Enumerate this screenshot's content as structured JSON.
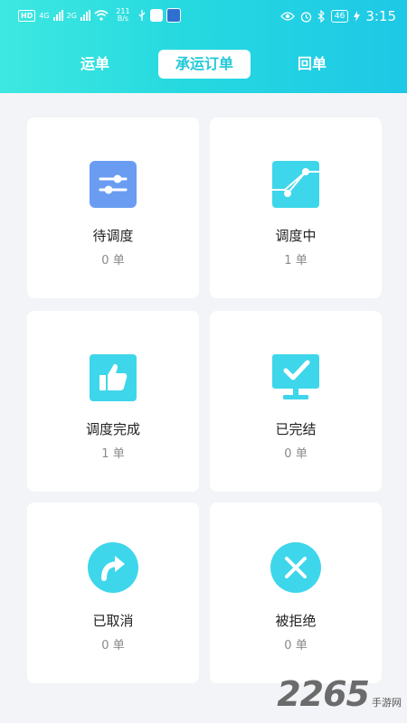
{
  "status_bar": {
    "hd_label": "HD",
    "network_1": "4G",
    "network_2": "2G",
    "speed": "211 B/s",
    "battery": "46",
    "time": "3:15"
  },
  "tabs": [
    {
      "label": "运单",
      "active": false
    },
    {
      "label": "承运订单",
      "active": true
    },
    {
      "label": "回单",
      "active": false
    }
  ],
  "cards": [
    {
      "title": "待调度",
      "count": "0 单",
      "icon": "sliders-icon",
      "color": "#6a9cf2"
    },
    {
      "title": "调度中",
      "count": "1 单",
      "icon": "route-icon",
      "color": "#3ed6ea"
    },
    {
      "title": "调度完成",
      "count": "1 单",
      "icon": "thumbs-up-icon",
      "color": "#3ed6ea"
    },
    {
      "title": "已完结",
      "count": "0 单",
      "icon": "monitor-check-icon",
      "color": "#3ed6ea"
    },
    {
      "title": "已取消",
      "count": "0 单",
      "icon": "redo-arrow-icon",
      "color": "#3ed6ea"
    },
    {
      "title": "被拒绝",
      "count": "0 单",
      "icon": "close-icon",
      "color": "#3ed6ea"
    }
  ],
  "watermark": {
    "number": "2265",
    "text": "手游网"
  },
  "colors": {
    "header_start": "#3ee8e1",
    "header_end": "#1ec8e6",
    "accent": "#22c9d8",
    "blue_icon": "#6a9cf2"
  }
}
